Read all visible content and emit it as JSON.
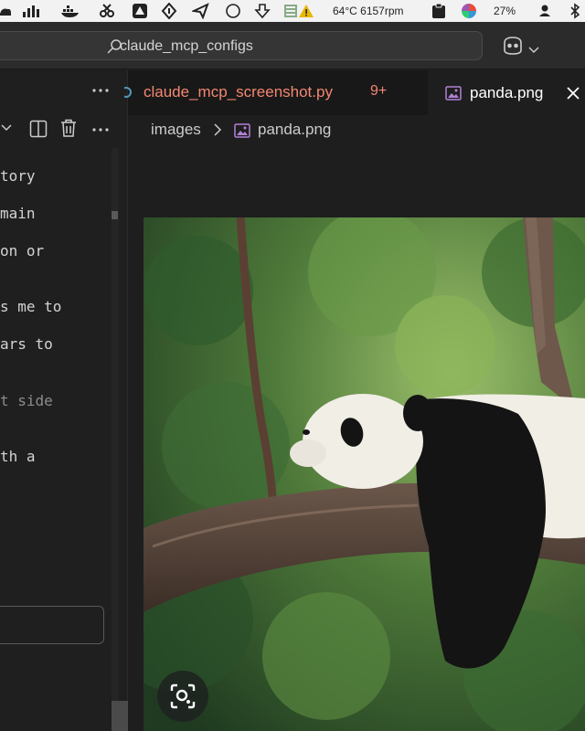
{
  "menubar": {
    "temp_fan": "64°C 6157rpm",
    "battery_percent": "27%",
    "icons": [
      "cloud-icon",
      "stats-icon",
      "docker-icon",
      "tool-icon",
      "drive-icon",
      "vpn-icon",
      "location-icon",
      "circle-icon",
      "download-icon",
      "status-warning-icon",
      "clipboard-icon",
      "color-wheel-icon",
      "user-icon",
      "bluetooth-icon"
    ]
  },
  "titlebar": {
    "search_text": "claude_mcp_configs",
    "copilot_icon": "copilot-icon"
  },
  "sidebar": {
    "more_actions_icon": "ellipsis-icon",
    "toolbar_icons": [
      "chevron-down-icon",
      "split-editor-icon",
      "trash-icon",
      "ellipsis-icon"
    ],
    "lines": [
      "tory",
      "main",
      "on or",
      "s me to",
      "ars to",
      "t side",
      "th a"
    ]
  },
  "tabs": [
    {
      "label": "claude_mcp_screenshot.py",
      "badge": "9+",
      "color": "#f48771",
      "active": false
    },
    {
      "label": "panda.png",
      "active": true
    }
  ],
  "breadcrumb": {
    "folder": "images",
    "file": "panda.png"
  },
  "colors": {
    "accent_error": "#f48771",
    "image_icon": "#b180d7",
    "editor_bg": "#1e1e1e"
  }
}
